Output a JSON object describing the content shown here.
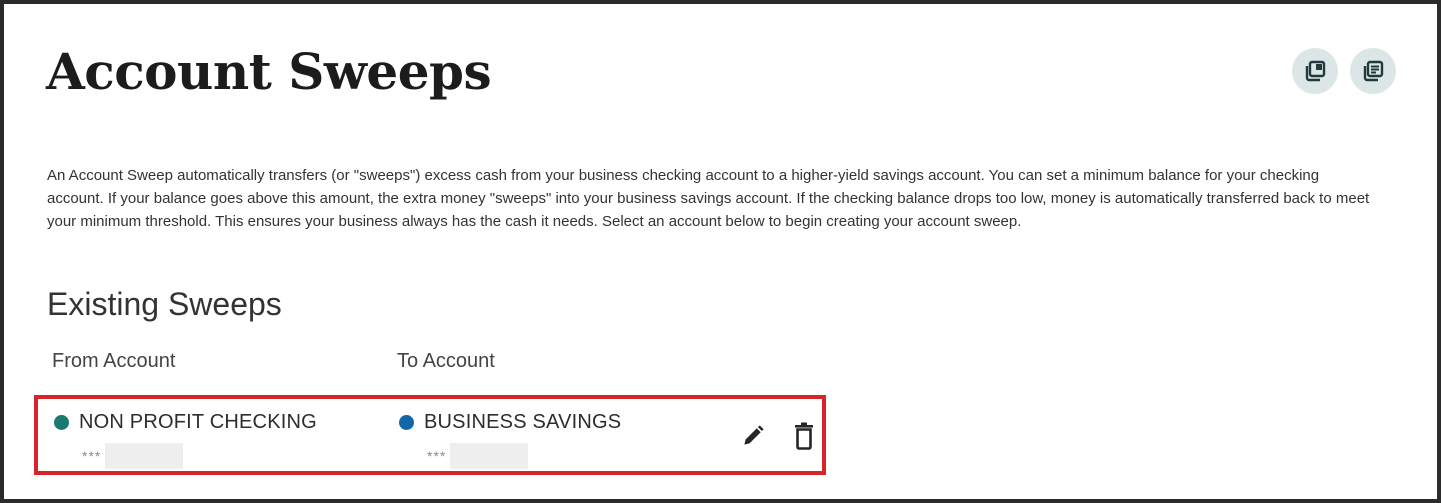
{
  "page": {
    "title": "Account Sweeps",
    "header_icons": [
      "copy-icon",
      "document-icon"
    ],
    "description": "An Account Sweep automatically transfers (or \"sweeps\") excess cash from your business checking account to a higher-yield savings account. You can set a minimum balance for your checking account. If your balance goes above this amount, the extra money \"sweeps\" into your business savings account. If the checking balance drops too low, money is automatically transferred back to meet your minimum threshold. This ensures your business always has the cash it needs. Select an account below to begin creating your account sweep."
  },
  "existing_sweeps": {
    "heading": "Existing Sweeps",
    "columns": {
      "from": "From Account",
      "to": "To Account"
    },
    "rows": [
      {
        "from": {
          "name": "NON PROFIT CHECKING",
          "masked_number": "***",
          "dot_color": "#1a7a70"
        },
        "to": {
          "name": "BUSINESS SAVINGS",
          "masked_number": "***",
          "dot_color": "#1466a8"
        },
        "actions": [
          "pencil-icon",
          "trash-icon"
        ],
        "highlight_color": "#d8232a"
      }
    ]
  }
}
